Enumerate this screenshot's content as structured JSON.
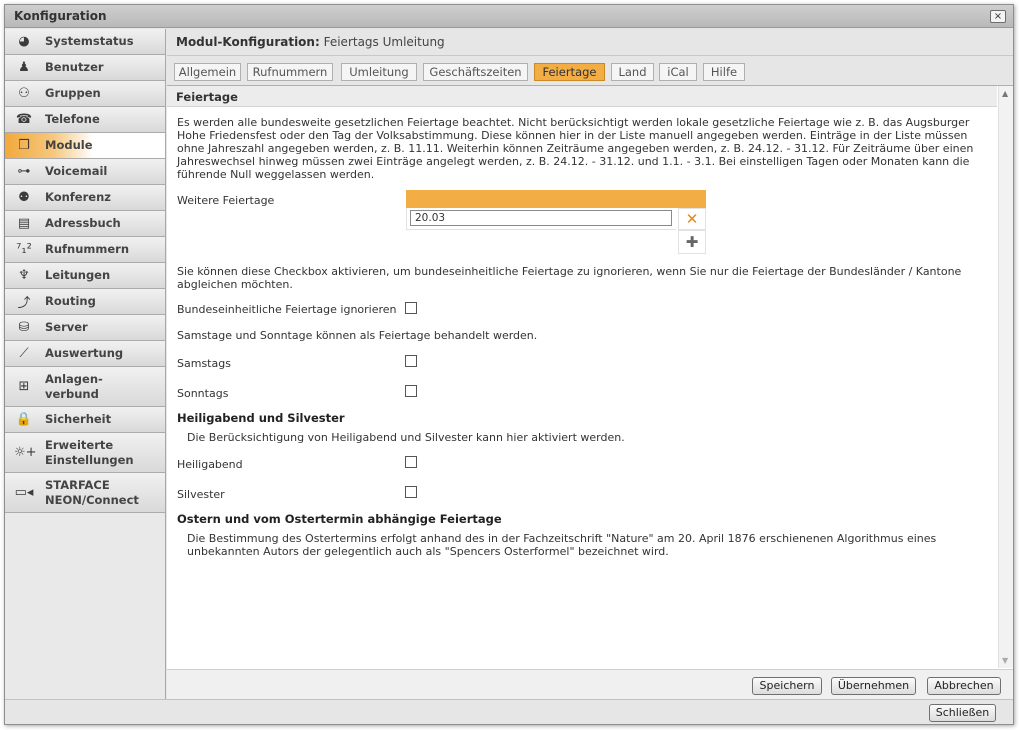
{
  "window": {
    "title": "Konfiguration",
    "close_glyph": "×"
  },
  "sidebar": {
    "items": [
      {
        "label": "Systemstatus",
        "icon": "◕"
      },
      {
        "label": "Benutzer",
        "icon": "♟"
      },
      {
        "label": "Gruppen",
        "icon": "⚇"
      },
      {
        "label": "Telefone",
        "icon": "☎"
      },
      {
        "label": "Module",
        "icon": "❒"
      },
      {
        "label": "Voicemail",
        "icon": "⊶"
      },
      {
        "label": "Konferenz",
        "icon": "⚉"
      },
      {
        "label": "Adressbuch",
        "icon": "▤"
      },
      {
        "label": "Rufnummern",
        "icon": "⁷₁²"
      },
      {
        "label": "Leitungen",
        "icon": "♆"
      },
      {
        "label": "Routing",
        "icon": "⤴"
      },
      {
        "label": "Server",
        "icon": "⛁"
      },
      {
        "label": "Auswertung",
        "icon": "⟋"
      },
      {
        "label1": "Anlagen-",
        "label2": "verbund",
        "icon": "⊞"
      },
      {
        "label": "Sicherheit",
        "icon": "🔒"
      },
      {
        "label1": "Erweiterte",
        "label2": "Einstellungen",
        "icon": "☼+"
      },
      {
        "label1": "STARFACE",
        "label2": "NEON/Connect",
        "icon": "▭◂"
      }
    ],
    "active": "Module"
  },
  "header": {
    "prefix": "Modul-Konfiguration:",
    "module_name": "Feiertags Umleitung"
  },
  "tabs": [
    "Allgemein",
    "Rufnummern",
    "Umleitung",
    "Geschäftszeiten",
    "Feiertage",
    "Land",
    "iCal",
    "Hilfe"
  ],
  "active_tab": "Feiertage",
  "section_title": "Feiertage",
  "content": {
    "intro": [
      "Es werden alle bundesweite gesetzlichen Feiertage beachtet. Nicht berücksichtigt werden lokale gesetzliche Feiertage wie z. B. das Augsburger",
      "Hohe Friedensfest oder den Tag der Volksabstimmung. Diese können hier in der Liste manuell angegeben werden. Einträge in der Liste müssen",
      "ohne Jahreszahl angegeben werden, z. B. 11.11. Weiterhin können Zeiträume angegeben werden, z. B. 24.12. - 31.12. Für Zeiträume über einen",
      "Jahreswechsel hinweg müssen zwei Einträge angelegt werden, z. B. 24.12. - 31.12. und 1.1. - 3.1. Bei einstelligen Tagen oder Monaten kann die",
      "führende Null weggelassen werden."
    ],
    "weitere_label": "Weitere Feiertage",
    "weitere_value": "20.03",
    "checkbox_info": [
      "Sie können diese Checkbox aktivieren, um bundeseinheitliche Feiertage zu ignorieren, wenn Sie nur die Feiertage der Bundesländer / Kantone",
      "abgleichen möchten."
    ],
    "ignore_label": "Bundeseinheitliche Feiertage ignorieren",
    "weekend_info": "Samstage und Sonntage können als Feiertage behandelt werden.",
    "samstags_label": "Samstags",
    "sonntags_label": "Sonntags",
    "heilig_heading": "Heiligabend und Silvester",
    "heilig_info": "Die Berücksichtigung von Heiligabend und Silvester kann hier aktiviert werden.",
    "heiligabend_label": "Heiligabend",
    "silvester_label": "Silvester",
    "ostern_heading": "Ostern und vom Ostertermin abhängige Feiertage",
    "ostern_info": [
      "Die Bestimmung des Ostertermins erfolgt anhand des in der Fachzeitschrift \"Nature\" am 20. April 1876 erschienenen Algorithmus eines",
      "unbekannten Autors der gelegentlich auch als \"Spencers Osterformel\" bezeichnet wird."
    ],
    "checkboxes": {
      "ignore": false,
      "samstags": false,
      "sonntags": false,
      "heiligabend": false,
      "silvester": false
    }
  },
  "buttons": {
    "save": "Speichern",
    "apply": "Übernehmen",
    "cancel": "Abbrechen",
    "close": "Schließen"
  },
  "icons": {
    "delete": "✕",
    "add": "✚",
    "scroll_up": "▲",
    "scroll_down": "▼"
  },
  "colors": {
    "accent": "#f2ae44"
  }
}
